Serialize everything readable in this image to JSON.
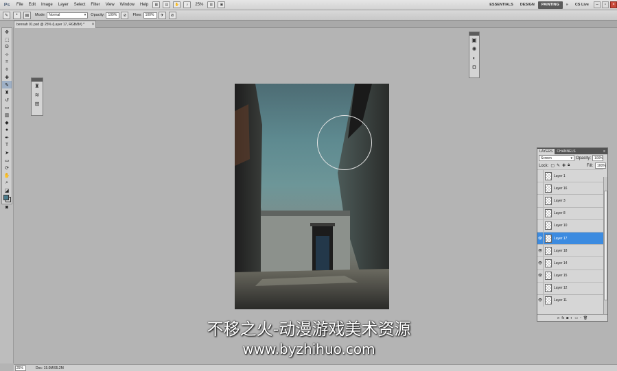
{
  "app": {
    "logo": "Ps"
  },
  "menu": [
    "File",
    "Edit",
    "Image",
    "Layer",
    "Select",
    "Filter",
    "View",
    "Window",
    "Help"
  ],
  "zoom_level": "25%",
  "workspaces": {
    "essentials": "ESSENTIALS",
    "design": "DESIGN",
    "painting": "PAINTING",
    "more": "»",
    "cslive": "CS Live"
  },
  "options": {
    "mode_label": "Mode:",
    "mode_value": "Normal",
    "opacity_label": "Opacity:",
    "opacity_value": "100%",
    "flow_label": "Flow:",
    "flow_value": "100%"
  },
  "document": {
    "tab_title": "bennah 01.psd @ 25% (Layer 17, RGB/8#) *",
    "close": "×"
  },
  "layers_panel": {
    "tabs": [
      "LAYERS",
      "CHANNELS"
    ],
    "blend_mode": "Screen",
    "opacity_label": "Opacity:",
    "opacity_value": "100%",
    "lock_label": "Lock:",
    "fill_label": "Fill:",
    "fill_value": "100%",
    "layers": [
      {
        "name": "Layer 1",
        "visible": false,
        "active": false
      },
      {
        "name": "Layer 16",
        "visible": false,
        "active": false
      },
      {
        "name": "Layer 3",
        "visible": false,
        "active": false
      },
      {
        "name": "Layer 8",
        "visible": false,
        "active": false
      },
      {
        "name": "Layer 10",
        "visible": false,
        "active": false
      },
      {
        "name": "Layer 17",
        "visible": true,
        "active": true
      },
      {
        "name": "Layer 18",
        "visible": true,
        "active": false
      },
      {
        "name": "Layer 14",
        "visible": true,
        "active": false
      },
      {
        "name": "Layer 15",
        "visible": true,
        "active": false
      },
      {
        "name": "Layer 12",
        "visible": false,
        "active": false
      },
      {
        "name": "Layer 11",
        "visible": true,
        "active": false
      }
    ]
  },
  "status": {
    "zoom": "25%",
    "doc": "Doc: 15.0M/95.2M"
  },
  "watermark": {
    "line1": "不移之火-动漫游戏美术资源",
    "line2": "www.byzhihuo.com"
  }
}
